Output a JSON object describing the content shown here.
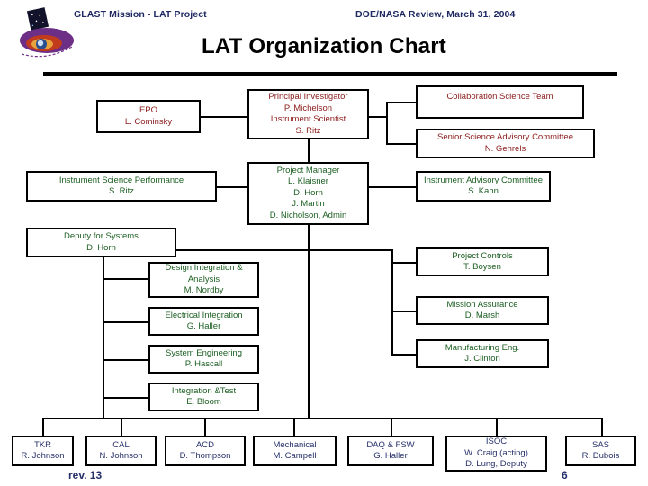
{
  "header": {
    "left": "GLAST Mission - LAT Project",
    "right": "DOE/NASA Review, March 31, 2004",
    "logo_icon": "glast-mission-logo-icon"
  },
  "title": "LAT Organization Chart",
  "footer": {
    "revision": "rev. 13",
    "page_number": "6"
  },
  "colors": {
    "header_text": "#1f2a63",
    "title_text": "#000000",
    "leadership_text": "#8b1a1a",
    "management_text": "#1b5e20",
    "subsystem_text": "#26306b",
    "line": "#000000",
    "box_border": "#000000",
    "background": "#ffffff"
  },
  "boxes": [
    {
      "id": "epo",
      "lines": [
        "EPO",
        "L. Cominsky"
      ]
    },
    {
      "id": "pi",
      "lines": [
        "Principal Investigator",
        "P. Michelson",
        "Instrument Scientist",
        "S. Ritz"
      ]
    },
    {
      "id": "collab",
      "lines": [
        "Collaboration Science Team"
      ]
    },
    {
      "id": "ssac",
      "lines": [
        "Senior Science Advisory Committee",
        "N. Gehrels"
      ]
    },
    {
      "id": "isp",
      "lines": [
        "Instrument Science Performance",
        "S. Ritz"
      ]
    },
    {
      "id": "pm",
      "lines": [
        "Project Manager",
        "L. Klaisner",
        "D. Horn",
        "J. Martin",
        "D. Nicholson, Admin"
      ]
    },
    {
      "id": "iac",
      "lines": [
        "Instrument Advisory  Committee",
        "S. Kahn"
      ]
    },
    {
      "id": "deputy",
      "lines": [
        "Deputy for Systems",
        "D. Horn"
      ]
    },
    {
      "id": "design",
      "lines": [
        "Design Integration &",
        "Analysis",
        "M. Nordby"
      ]
    },
    {
      "id": "electrical",
      "lines": [
        "Electrical Integration",
        "G. Haller"
      ]
    },
    {
      "id": "sysengr",
      "lines": [
        "System Engineering",
        "P. Hascall"
      ]
    },
    {
      "id": "inttest",
      "lines": [
        "Integration &Test",
        "E. Bloom"
      ]
    },
    {
      "id": "controls",
      "lines": [
        "Project Controls",
        "T. Boysen"
      ]
    },
    {
      "id": "assurance",
      "lines": [
        "Mission Assurance",
        "D. Marsh"
      ]
    },
    {
      "id": "manufacturing",
      "lines": [
        "Manufacturing Eng.",
        "J. Clinton"
      ]
    },
    {
      "id": "tkr",
      "lines": [
        "TKR",
        "R. Johnson"
      ]
    },
    {
      "id": "cal",
      "lines": [
        "CAL",
        "N. Johnson"
      ]
    },
    {
      "id": "acd",
      "lines": [
        "ACD",
        "D. Thompson"
      ]
    },
    {
      "id": "mechanical",
      "lines": [
        "Mechanical",
        "M. Campell"
      ]
    },
    {
      "id": "daqfsw",
      "lines": [
        "DAQ & FSW",
        "G. Haller"
      ]
    },
    {
      "id": "isoc",
      "lines": [
        "ISOC",
        "W. Craig (acting)",
        "D. Lung, Deputy"
      ]
    },
    {
      "id": "sas",
      "lines": [
        "SAS",
        "R. Dubois"
      ]
    }
  ]
}
